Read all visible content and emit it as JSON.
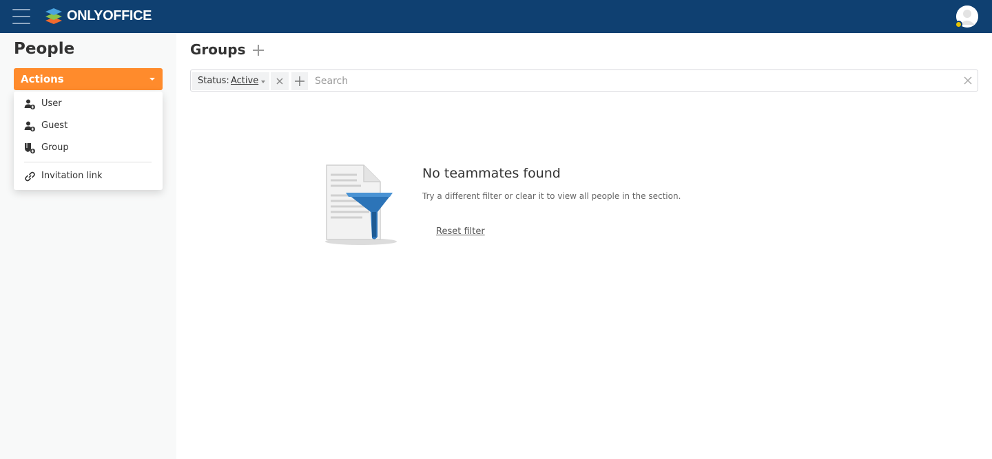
{
  "header": {
    "logo_text": "ONLYOFFICE",
    "colors": {
      "bg": "#0f4071",
      "logo_orange": "#f26a2e",
      "logo_green": "#8bc34a",
      "logo_blue": "#4aa3df",
      "badge": "#e6c200"
    }
  },
  "sidebar": {
    "title": "People",
    "actions_label": "Actions",
    "actions_color": "#ff8b2c",
    "menu": [
      {
        "label": "User",
        "icon": "user-add-icon"
      },
      {
        "label": "Guest",
        "icon": "guest-add-icon"
      },
      {
        "label": "Group",
        "icon": "group-add-icon"
      },
      {
        "label": "Invitation link",
        "icon": "link-icon"
      }
    ]
  },
  "main": {
    "title": "Groups",
    "filter": {
      "status_key": "Status:",
      "status_value": "Active",
      "search_placeholder": "Search"
    },
    "empty": {
      "title": "No teammates found",
      "description": "Try a different filter or clear it to view all people in the section.",
      "reset_label": "Reset filter"
    }
  }
}
